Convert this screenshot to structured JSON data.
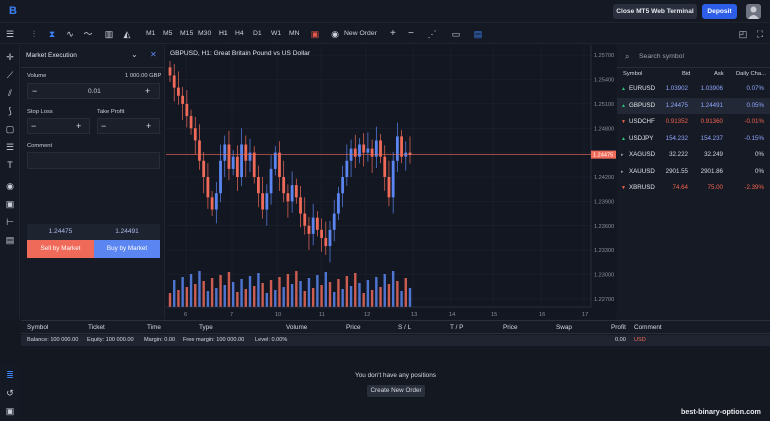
{
  "header": {
    "logo_letter": "B",
    "close_button": "Close MT5 Web Terminal",
    "deposit_button": "Deposit"
  },
  "toolbar": {
    "timeframes": [
      "M1",
      "M5",
      "M15",
      "M30",
      "H1",
      "H4",
      "D1",
      "W1",
      "MN"
    ],
    "active_timeframe": "H1",
    "new_order": "New Order",
    "plus": "+",
    "minus": "−"
  },
  "order_panel": {
    "mode": "Market Execution",
    "volume_label": "Volume",
    "volume_hint": "1 000.00 GBP",
    "volume_value": "0.01",
    "stop_loss_label": "Stop Loss",
    "take_profit_label": "Take Profit",
    "comment_label": "Comment",
    "bid": "1.24475",
    "ask": "1.24491",
    "sell_button": "Sell by Market",
    "buy_button": "Buy by Market",
    "minus": "−",
    "plus": "+"
  },
  "chart": {
    "title": "GBPUSD, H1: Great Britain Pound vs US Dollar",
    "current_price": "1.24475",
    "price_ticks": [
      "1.25700",
      "1.25400",
      "1.25100",
      "1.24800",
      "1.24500",
      "1.24200",
      "1.23900",
      "1.23600",
      "1.23300",
      "1.23000",
      "1.22700"
    ],
    "date_ticks": [
      "6",
      "7",
      "10",
      "11",
      "12",
      "13",
      "14",
      "15",
      "16",
      "17"
    ]
  },
  "chart_data": {
    "type": "candlestick",
    "title": "GBPUSD, H1: Great Britain Pound vs US Dollar",
    "x_axis_labels": [
      "6",
      "7",
      "10",
      "11",
      "12",
      "13",
      "14",
      "15",
      "16",
      "17"
    ],
    "ylim": [
      1.226,
      1.258
    ],
    "last_price": 1.24475,
    "series": [
      {
        "name": "close",
        "values": [
          1.2545,
          1.253,
          1.252,
          1.251,
          1.2495,
          1.248,
          1.2465,
          1.244,
          1.242,
          1.2395,
          1.238,
          1.24,
          1.244,
          1.246,
          1.243,
          1.2445,
          1.242,
          1.246,
          1.244,
          1.245,
          1.242,
          1.24,
          1.238,
          1.24,
          1.243,
          1.245,
          1.242,
          1.24,
          1.239,
          1.241,
          1.2395,
          1.2375,
          1.236,
          1.235,
          1.237,
          1.2355,
          1.2345,
          1.2335,
          1.2355,
          1.2375,
          1.24,
          1.242,
          1.244,
          1.2455,
          1.2445,
          1.246,
          1.245,
          1.2455,
          1.2445,
          1.2465,
          1.2445,
          1.242,
          1.2395,
          1.244,
          1.247,
          1.2445,
          1.245,
          1.24475
        ]
      }
    ]
  },
  "watchlist": {
    "search_placeholder": "Search symbol",
    "columns": [
      "Symbol",
      "Bid",
      "Ask",
      "Daily Cha..."
    ],
    "rows": [
      {
        "symbol": "EURUSD",
        "bid": "1.03902",
        "ask": "1.03906",
        "change": "0.07%",
        "dir": "up",
        "color": "#8fa6ff"
      },
      {
        "symbol": "GBPUSD",
        "bid": "1.24475",
        "ask": "1.24491",
        "change": "0.05%",
        "dir": "up",
        "color": "#8fa6ff"
      },
      {
        "symbol": "USDCHF",
        "bid": "0.91352",
        "ask": "0.91360",
        "change": "-0.01%",
        "dir": "down",
        "color": "#f0644f"
      },
      {
        "symbol": "USDJPY",
        "bid": "154.232",
        "ask": "154.237",
        "change": "-0.15%",
        "dir": "up",
        "color": "#8fa6ff"
      },
      {
        "symbol": "XAGUSD",
        "bid": "32.222",
        "ask": "32.249",
        "change": "0%",
        "dir": "flat",
        "color": "#d5d9e1"
      },
      {
        "symbol": "XAUUSD",
        "bid": "2901.55",
        "ask": "2901.86",
        "change": "0%",
        "dir": "flat",
        "color": "#d5d9e1"
      },
      {
        "symbol": "XBRUSD",
        "bid": "74.64",
        "ask": "75.00",
        "change": "-2.39%",
        "dir": "down",
        "color": "#f0644f"
      }
    ]
  },
  "positions": {
    "columns": [
      "Symbol",
      "Ticket",
      "Time",
      "Type",
      "Volume",
      "Price",
      "S / L",
      "T / P",
      "Price",
      "Swap",
      "Profit",
      "Comment"
    ],
    "balance": "Balance: 100 000.00",
    "equity": "Equity: 100 000.00",
    "margin": "Margin: 0.00",
    "free_margin": "Free margin: 100 000.00",
    "level": "Level: 0.00%",
    "profit": "0.00",
    "currency": "USD",
    "empty_message": "You don't have any positions",
    "create_button": "Create New Order"
  },
  "watermark": "best-binary-option.com"
}
